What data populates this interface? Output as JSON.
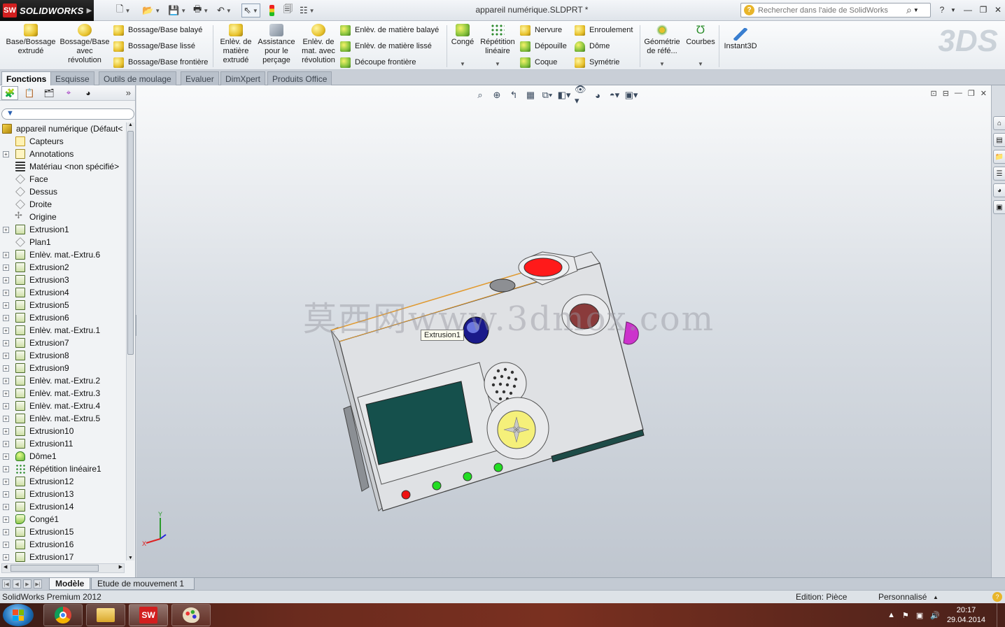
{
  "app": {
    "logo_text": "SOLIDWORKS",
    "logo_mark": "SW",
    "document_title": "appareil numérique.SLDPRT *",
    "search_placeholder": "Rechercher dans l'aide de SolidWorks"
  },
  "ribbon": {
    "large_buttons": [
      {
        "label1": "Base/Bossage",
        "label2": "extrudé",
        "label3": ""
      },
      {
        "label1": "Bossage/Base",
        "label2": "avec",
        "label3": "révolution"
      },
      {
        "label1": "Enlèv. de",
        "label2": "matière",
        "label3": "extrudé"
      },
      {
        "label1": "Assistance",
        "label2": "pour le",
        "label3": "perçage"
      },
      {
        "label1": "Enlèv. de",
        "label2": "mat. avec",
        "label3": "révolution"
      },
      {
        "label1": "Congé",
        "label2": "",
        "label3": ""
      },
      {
        "label1": "Répétition",
        "label2": "linéaire",
        "label3": ""
      },
      {
        "label1": "Géométrie",
        "label2": "de réfé...",
        "label3": ""
      },
      {
        "label1": "Courbes",
        "label2": "",
        "label3": ""
      },
      {
        "label1": "Instant3D",
        "label2": "",
        "label3": ""
      }
    ],
    "small_buttons": [
      {
        "label": "Bossage/Base balayé"
      },
      {
        "label": "Bossage/Base lissé"
      },
      {
        "label": "Bossage/Base frontière"
      },
      {
        "label": "Enlèv. de matière balayé"
      },
      {
        "label": "Enlèv. de matière lissé"
      },
      {
        "label": "Découpe frontière"
      },
      {
        "label": "Nervure"
      },
      {
        "label": "Dépouille"
      },
      {
        "label": "Coque"
      },
      {
        "label": "Enroulement"
      },
      {
        "label": "Dôme"
      },
      {
        "label": "Symétrie"
      }
    ]
  },
  "tabs": [
    {
      "label": "Fonctions",
      "active": true
    },
    {
      "label": "Esquisse",
      "active": false
    },
    {
      "label": "Outils de moulage",
      "active": false
    },
    {
      "label": "Evaluer",
      "active": false
    },
    {
      "label": "DimXpert",
      "active": false
    },
    {
      "label": "Produits Office",
      "active": false
    }
  ],
  "feature_tree": {
    "root": "appareil numérique  (Défaut<",
    "items": [
      {
        "label": "Capteurs",
        "icon": "sensors-icon"
      },
      {
        "label": "Annotations",
        "icon": "annotations-icon"
      },
      {
        "label": "Matériau <non spécifié>",
        "icon": "material-icon"
      },
      {
        "label": "Face",
        "icon": "plane-icon"
      },
      {
        "label": "Dessus",
        "icon": "plane-icon"
      },
      {
        "label": "Droite",
        "icon": "plane-icon"
      },
      {
        "label": "Origine",
        "icon": "origin-icon"
      },
      {
        "label": "Extrusion1",
        "icon": "extrude-icon"
      },
      {
        "label": "Plan1",
        "icon": "plane-icon"
      },
      {
        "label": "Enlèv. mat.-Extru.6",
        "icon": "cut-extrude-icon"
      },
      {
        "label": "Extrusion2",
        "icon": "extrude-icon"
      },
      {
        "label": "Extrusion3",
        "icon": "extrude-icon"
      },
      {
        "label": "Extrusion4",
        "icon": "extrude-icon"
      },
      {
        "label": "Extrusion5",
        "icon": "extrude-icon"
      },
      {
        "label": "Extrusion6",
        "icon": "extrude-icon"
      },
      {
        "label": "Enlèv. mat.-Extru.1",
        "icon": "cut-extrude-icon"
      },
      {
        "label": "Extrusion7",
        "icon": "extrude-icon"
      },
      {
        "label": "Extrusion8",
        "icon": "extrude-icon"
      },
      {
        "label": "Extrusion9",
        "icon": "extrude-icon"
      },
      {
        "label": "Enlèv. mat.-Extru.2",
        "icon": "cut-extrude-icon"
      },
      {
        "label": "Enlèv. mat.-Extru.3",
        "icon": "cut-extrude-icon"
      },
      {
        "label": "Enlèv. mat.-Extru.4",
        "icon": "cut-extrude-icon"
      },
      {
        "label": "Enlèv. mat.-Extru.5",
        "icon": "cut-extrude-icon"
      },
      {
        "label": "Extrusion10",
        "icon": "extrude-icon"
      },
      {
        "label": "Extrusion11",
        "icon": "extrude-icon"
      },
      {
        "label": "Dôme1",
        "icon": "dome-icon"
      },
      {
        "label": "Répétition linéaire1",
        "icon": "linear-pattern-icon"
      },
      {
        "label": "Extrusion12",
        "icon": "extrude-icon"
      },
      {
        "label": "Extrusion13",
        "icon": "extrude-icon"
      },
      {
        "label": "Extrusion14",
        "icon": "extrude-icon"
      },
      {
        "label": "Congé1",
        "icon": "fillet-icon"
      },
      {
        "label": "Extrusion15",
        "icon": "extrude-icon"
      },
      {
        "label": "Extrusion16",
        "icon": "extrude-icon"
      },
      {
        "label": "Extrusion17",
        "icon": "extrude-icon"
      }
    ]
  },
  "viewport": {
    "tooltip": "Extrusion1",
    "watermark": "莫西网www.3dmox.com",
    "triad_y": "Y",
    "triad_x": "X"
  },
  "bottom_tabs": [
    {
      "label": "Modèle",
      "active": true
    },
    {
      "label": "Etude de mouvement 1",
      "active": false
    }
  ],
  "status": {
    "product": "SolidWorks Premium 2012",
    "edit_mode": "Edition: Pièce",
    "units": "Personnalisé"
  },
  "taskbar": {
    "time": "20:17",
    "date": "29.04.2014"
  },
  "colors": {
    "power_button": "#ff1a1a",
    "mode_dial": "#cc33cc",
    "lcd_screen": "#15504c",
    "led_red": "#ee1111",
    "led_green": "#22dd22",
    "dpad": "#f5f07a"
  }
}
